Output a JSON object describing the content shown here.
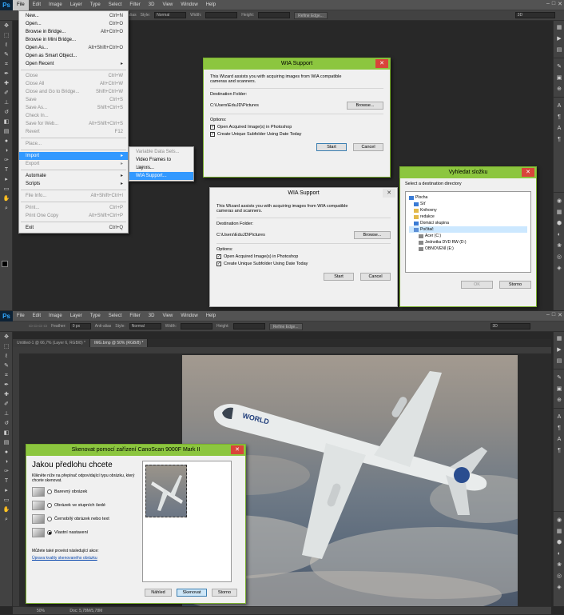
{
  "top": {
    "logo": "Ps",
    "menu": [
      "File",
      "Edit",
      "Image",
      "Layer",
      "Type",
      "Select",
      "Filter",
      "3D",
      "View",
      "Window",
      "Help"
    ],
    "options": {
      "anti_alias": "Anti-alias",
      "style_label": "Style:",
      "style_value": "Normal",
      "width_label": "Width:",
      "height_label": "Height:",
      "refine": "Refine Edge...",
      "workspace": "3D"
    },
    "file_menu": [
      {
        "label": "New...",
        "sc": "Ctrl+N"
      },
      {
        "label": "Open...",
        "sc": "Ctrl+O"
      },
      {
        "label": "Browse in Bridge...",
        "sc": "Alt+Ctrl+O"
      },
      {
        "label": "Browse in Mini Bridge...",
        "sc": ""
      },
      {
        "label": "Open As...",
        "sc": "Alt+Shift+Ctrl+O"
      },
      {
        "label": "Open as Smart Object...",
        "sc": ""
      },
      {
        "label": "Open Recent",
        "sc": "▸"
      },
      {
        "sep": true
      },
      {
        "label": "Close",
        "sc": "Ctrl+W",
        "dis": true
      },
      {
        "label": "Close All",
        "sc": "Alt+Ctrl+W",
        "dis": true
      },
      {
        "label": "Close and Go to Bridge...",
        "sc": "Shift+Ctrl+W",
        "dis": true
      },
      {
        "label": "Save",
        "sc": "Ctrl+S",
        "dis": true
      },
      {
        "label": "Save As...",
        "sc": "Shift+Ctrl+S",
        "dis": true
      },
      {
        "label": "Check In...",
        "sc": "",
        "dis": true
      },
      {
        "label": "Save for Web...",
        "sc": "Alt+Shift+Ctrl+S",
        "dis": true
      },
      {
        "label": "Revert",
        "sc": "F12",
        "dis": true
      },
      {
        "sep": true
      },
      {
        "label": "Place...",
        "sc": "",
        "dis": true
      },
      {
        "sep": true
      },
      {
        "label": "Import",
        "sc": "▸",
        "hl": true
      },
      {
        "label": "Export",
        "sc": "▸",
        "dis": true
      },
      {
        "sep": true
      },
      {
        "label": "Automate",
        "sc": "▸"
      },
      {
        "label": "Scripts",
        "sc": "▸"
      },
      {
        "sep": true
      },
      {
        "label": "File Info...",
        "sc": "Alt+Shift+Ctrl+I",
        "dis": true
      },
      {
        "sep": true
      },
      {
        "label": "Print...",
        "sc": "Ctrl+P",
        "dis": true
      },
      {
        "label": "Print One Copy",
        "sc": "Alt+Shift+Ctrl+P",
        "dis": true
      },
      {
        "sep": true
      },
      {
        "label": "Exit",
        "sc": "Ctrl+Q"
      }
    ],
    "import_menu": [
      {
        "label": "Variable Data Sets...",
        "dis": true
      },
      {
        "label": "Video Frames to Layers...",
        "dis": false
      },
      {
        "label": "Notes...",
        "dis": true
      },
      {
        "label": "WIA Support...",
        "hl": true
      }
    ]
  },
  "wia": {
    "title": "WIA Support",
    "intro": "This Wizard assists you with acquiring images from WIA compatible cameras and scanners.",
    "dest_label": "Destination Folder:",
    "path": "C:\\Users\\EduJD\\Pictures",
    "browse": "Browse...",
    "options_label": "Options:",
    "opt1": "Open Acquired Image(s) in Photoshop",
    "opt2": "Create Unique Subfolder Using Date Today",
    "start": "Start",
    "cancel": "Cancel",
    "close": "✕",
    "check": "✓"
  },
  "folder": {
    "title": "Vyhledat složku",
    "prompt": "Select a destination directory",
    "items": [
      "Plocha",
      "Síť",
      "Knihovny",
      "redakce",
      "Domácí skupina",
      "Počítač",
      "Acer (C:)",
      "Jednotka DVD RW (D:)",
      "OBNOVENÍ (E:)"
    ],
    "ok": "OK",
    "cancel": "Storno"
  },
  "bottom": {
    "feather_label": "Feather:",
    "feather_value": "0 px",
    "tabs": [
      "Untitled-1 @ 66,7% (Layer 6, RGB/8) *",
      "IMG.bmp @ 50% (RGB/8) *"
    ],
    "status_zoom": "50%",
    "status_doc": "Doc: 5,78M/5,78M"
  },
  "scan": {
    "title": "Skenovat pomocí zařízení CanoScan 9000F Mark II",
    "heading": "Jakou předlohu chcete",
    "desc": "Klikněte níže na přepínač odpovídající typu obrázku, který chcete skenovat.",
    "options": [
      "Barevný obrázek",
      "Obrázek ve stupních šedé",
      "Černobílý obrázek nebo text",
      "Vlastní nastavení"
    ],
    "more": "Můžete také provést následující akce:",
    "link": "Úprava kvality skenovaného obrázku",
    "preview": "Náhled",
    "scan": "Skenovat",
    "cancel": "Storno",
    "close": "✕"
  },
  "plane_text": "WORLD"
}
